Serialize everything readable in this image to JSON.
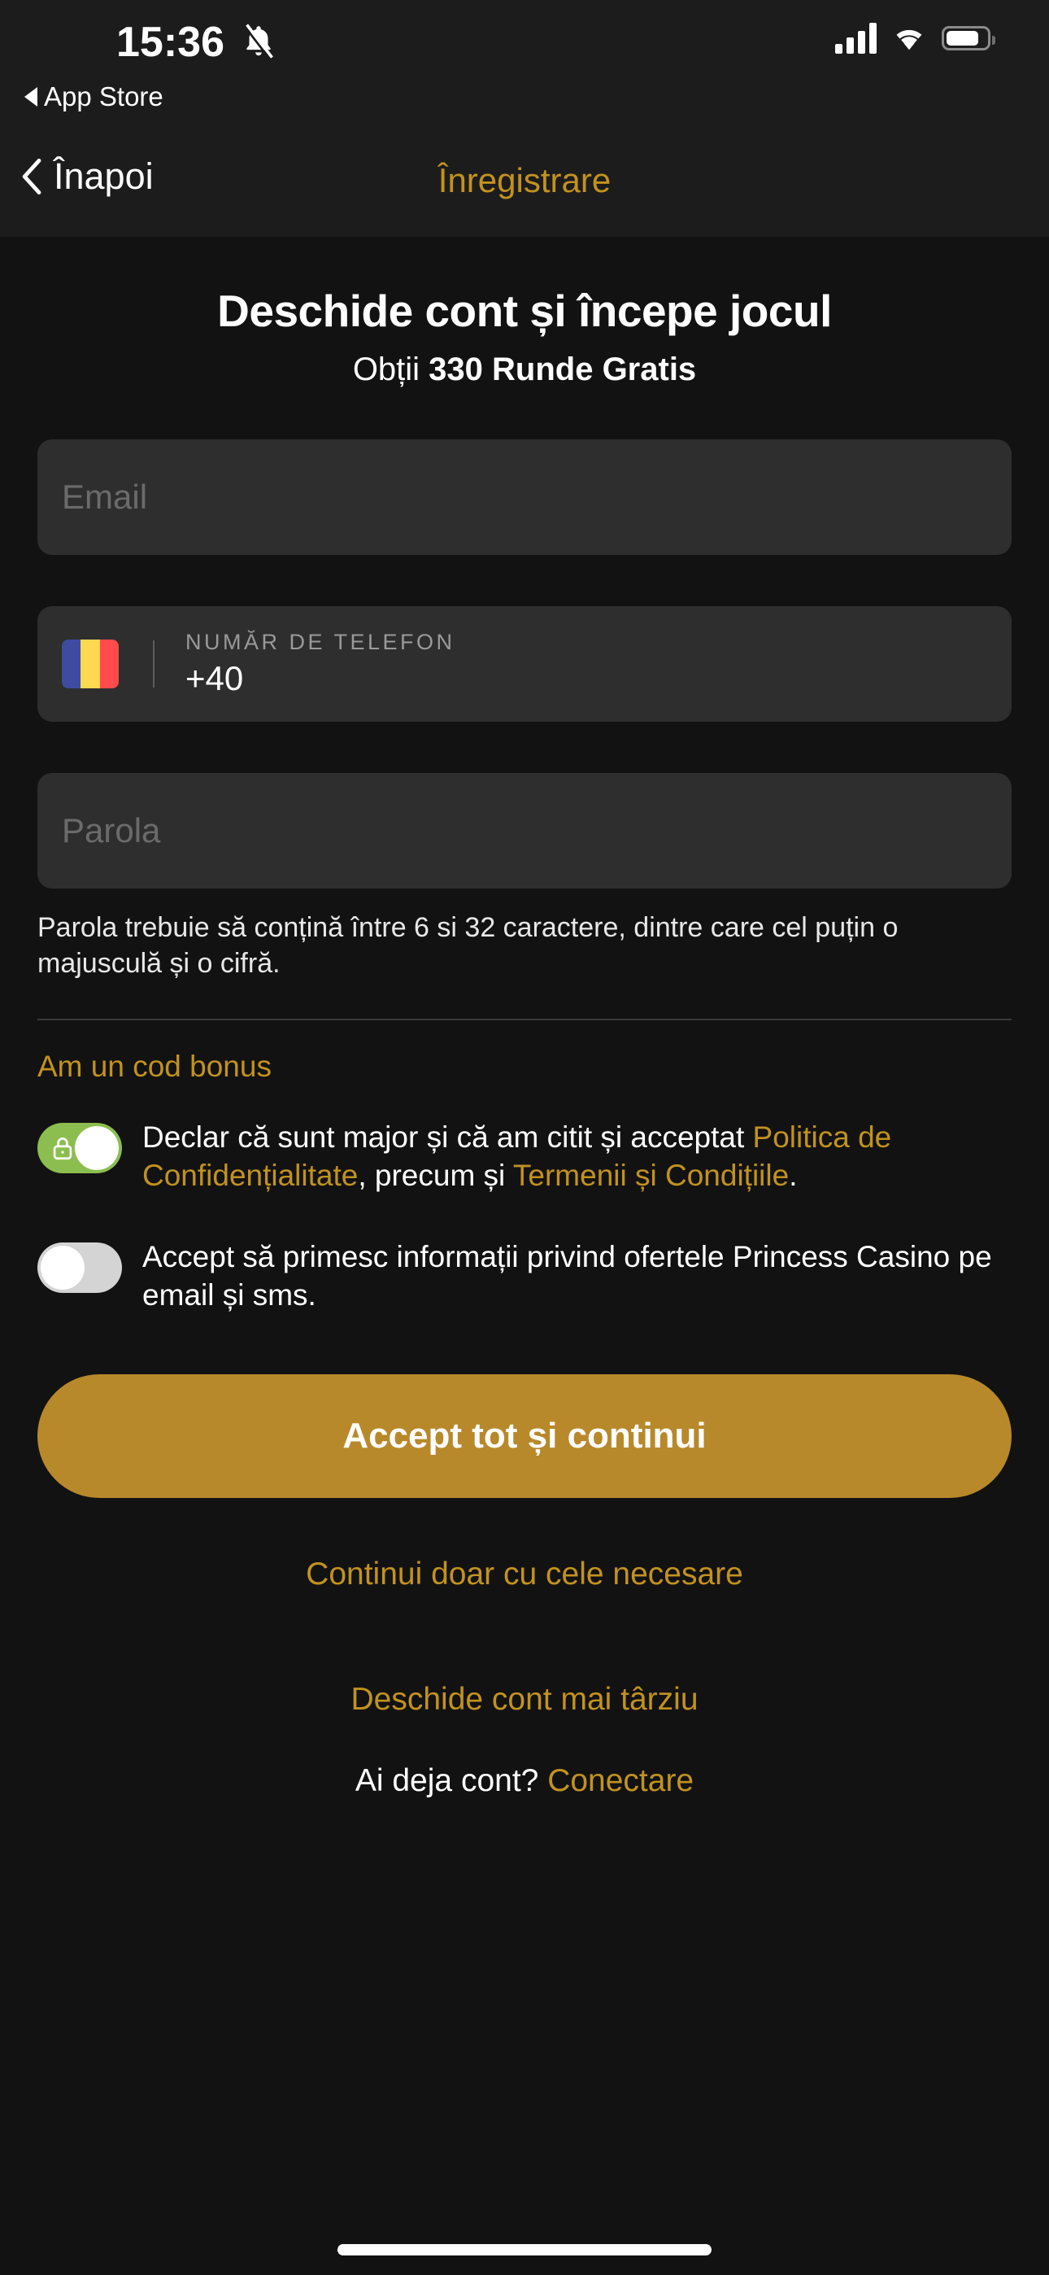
{
  "status_bar": {
    "time": "15:36",
    "mute_icon": "bell-slash-icon",
    "return_label": "App Store",
    "signal_icon": "cellular-signal-icon",
    "wifi_icon": "wifi-icon",
    "battery_icon": "battery-icon",
    "battery_level_percent": 72
  },
  "nav": {
    "back_label": "Înapoi",
    "back_icon": "chevron-left-icon",
    "title": "Înregistrare"
  },
  "header": {
    "headline": "Deschide cont și începe jocul",
    "subline_prefix": "Obții ",
    "subline_bold": "330 Runde Gratis"
  },
  "form": {
    "email": {
      "placeholder": "Email",
      "value": ""
    },
    "phone": {
      "country_flag": "romania-flag-icon",
      "label": "NUMĂR DE TELEFON",
      "dial_code": "+40",
      "value": ""
    },
    "password": {
      "placeholder": "Parola",
      "value": "",
      "helper": "Parola trebuie să conțină între 6 si 32 caractere, dintre care cel puțin o majusculă și o cifră."
    },
    "bonus_code_link": "Am un cod bonus"
  },
  "consents": [
    {
      "state": "on",
      "toggle_icon": "lock-icon",
      "text_part_1": "Declar că sunt major și că am citit și acceptat ",
      "link_1": "Politica de Confidențialitate",
      "text_part_2": ", precum și ",
      "link_2": "Termenii și Condițiile",
      "text_part_3": "."
    },
    {
      "state": "off",
      "text": "Accept să primesc informații privind ofertele Princess Casino pe email și sms."
    }
  ],
  "actions": {
    "primary_button": "Accept tot și continui",
    "secondary_link": "Continui doar cu cele necesare",
    "later_link": "Deschide cont mai târziu",
    "login_prompt": "Ai deja cont? ",
    "login_link": "Conectare"
  },
  "colors": {
    "accent_gold": "#c2921f",
    "button_gold": "#b8892b",
    "toggle_on_green": "#8cbe4f",
    "toggle_off_gray": "#d4d4d4",
    "background": "#121212",
    "chrome_background": "#1c1c1c",
    "field_background": "#2e2e2e",
    "flag_blue": "#3f4ba0",
    "flag_yellow": "#fcd94f",
    "flag_red": "#ff4b4b"
  }
}
